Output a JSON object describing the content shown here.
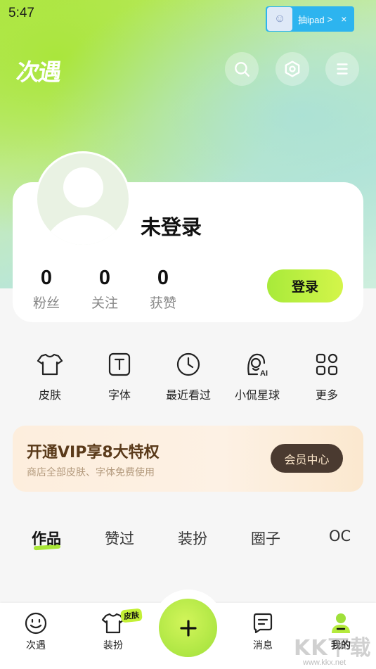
{
  "status_bar": {
    "time": "5:47"
  },
  "ad_banner": {
    "text": "抽ipad",
    "arrow": ">",
    "close": "×"
  },
  "header": {
    "logo": "次遇"
  },
  "profile": {
    "username": "未登录",
    "stats": [
      {
        "value": "0",
        "label": "粉丝"
      },
      {
        "value": "0",
        "label": "关注"
      },
      {
        "value": "0",
        "label": "获赞"
      }
    ],
    "login_label": "登录"
  },
  "menu": [
    {
      "label": "皮肤",
      "icon": "tshirt-icon"
    },
    {
      "label": "字体",
      "icon": "font-icon"
    },
    {
      "label": "最近看过",
      "icon": "clock-icon"
    },
    {
      "label": "小侃星球",
      "icon": "ai-avatar-icon"
    },
    {
      "label": "更多",
      "icon": "grid-icon"
    }
  ],
  "vip": {
    "title": "开通VIP享8大特权",
    "subtitle": "商店全部皮肤、字体免费使用",
    "button": "会员中心"
  },
  "tabs": [
    "作品",
    "赞过",
    "装扮",
    "圈子",
    "OC"
  ],
  "bottom_nav": {
    "items": [
      {
        "label": "次遇",
        "icon": "smile-icon"
      },
      {
        "label": "装扮",
        "icon": "tshirt-icon"
      },
      {
        "label": "消息",
        "icon": "message-icon"
      },
      {
        "label": "我的",
        "icon": "profile-icon"
      }
    ],
    "skin_badge": "皮肤"
  },
  "watermark": {
    "text": "KK下载",
    "url": "www.kkx.net"
  },
  "colors": {
    "accent": "#b4ea3c",
    "vip_button": "#4a3a30",
    "ad_blue": "#2db4ef"
  }
}
